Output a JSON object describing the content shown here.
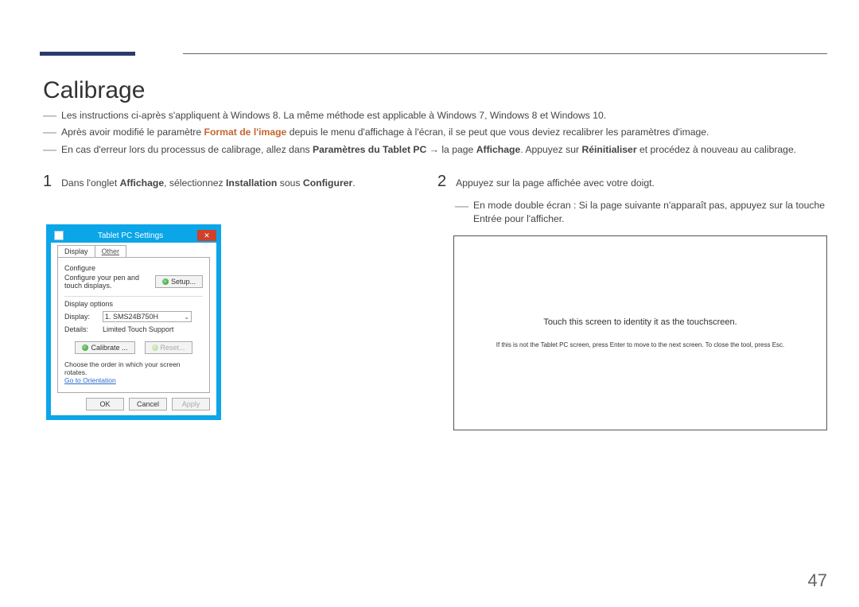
{
  "page": {
    "title": "Calibrage",
    "pageNumber": "47"
  },
  "intro": {
    "line1": "Les instructions ci-après s'appliquent à Windows 8. La même méthode est applicable à Windows 7, Windows 8 et Windows 10.",
    "line2_pre": "Après avoir modifié le paramètre ",
    "line2_highlight": "Format de l'image",
    "line2_post": " depuis le menu d'affichage à l'écran, il se peut que vous deviez recalibrer les paramètres d'image.",
    "line3_pre": "En cas d'erreur lors du processus de calibrage, allez dans ",
    "line3_b1": "Paramètres du Tablet PC",
    "line3_mid1": " → la page ",
    "line3_b2": "Affichage",
    "line3_mid2": ". Appuyez sur ",
    "line3_b3": "Réinitialiser",
    "line3_post": " et procédez à nouveau au calibrage."
  },
  "steps": {
    "num1": "1",
    "step1_pre": "Dans l'onglet ",
    "step1_b1": "Affichage",
    "step1_mid1": ", sélectionnez ",
    "step1_b2": "Installation",
    "step1_mid2": " sous ",
    "step1_b3": "Configurer",
    "step1_post": ".",
    "num2": "2",
    "step2": "Appuyez sur la page affichée avec votre doigt.",
    "sub2": "En mode double écran : Si la page suivante n'apparaît pas, appuyez sur la touche Entrée pour l'afficher."
  },
  "dialog": {
    "title": "Tablet PC Settings",
    "tabDisplay": "Display",
    "tabOther": "Other",
    "sectionConfigure": "Configure",
    "configText": "Configure your pen and touch displays.",
    "setupBtn": "Setup...",
    "sectionDisplayOptions": "Display options",
    "displayLabel": "Display:",
    "displayValue": "1. SMS24B750H",
    "detailsLabel": "Details:",
    "detailsValue": "Limited Touch Support",
    "calibrateBtn": "Calibrate ...",
    "resetBtn": "Reset...",
    "orderText": "Choose the order in which your screen rotates.",
    "orientationLink": "Go to Orientation",
    "okBtn": "OK",
    "cancelBtn": "Cancel",
    "applyBtn": "Apply"
  },
  "touchBox": {
    "main": "Touch this screen to identity it as the touchscreen.",
    "sub": "If this is not the Tablet PC screen, press Enter to move to the next screen. To close the tool, press Esc."
  }
}
